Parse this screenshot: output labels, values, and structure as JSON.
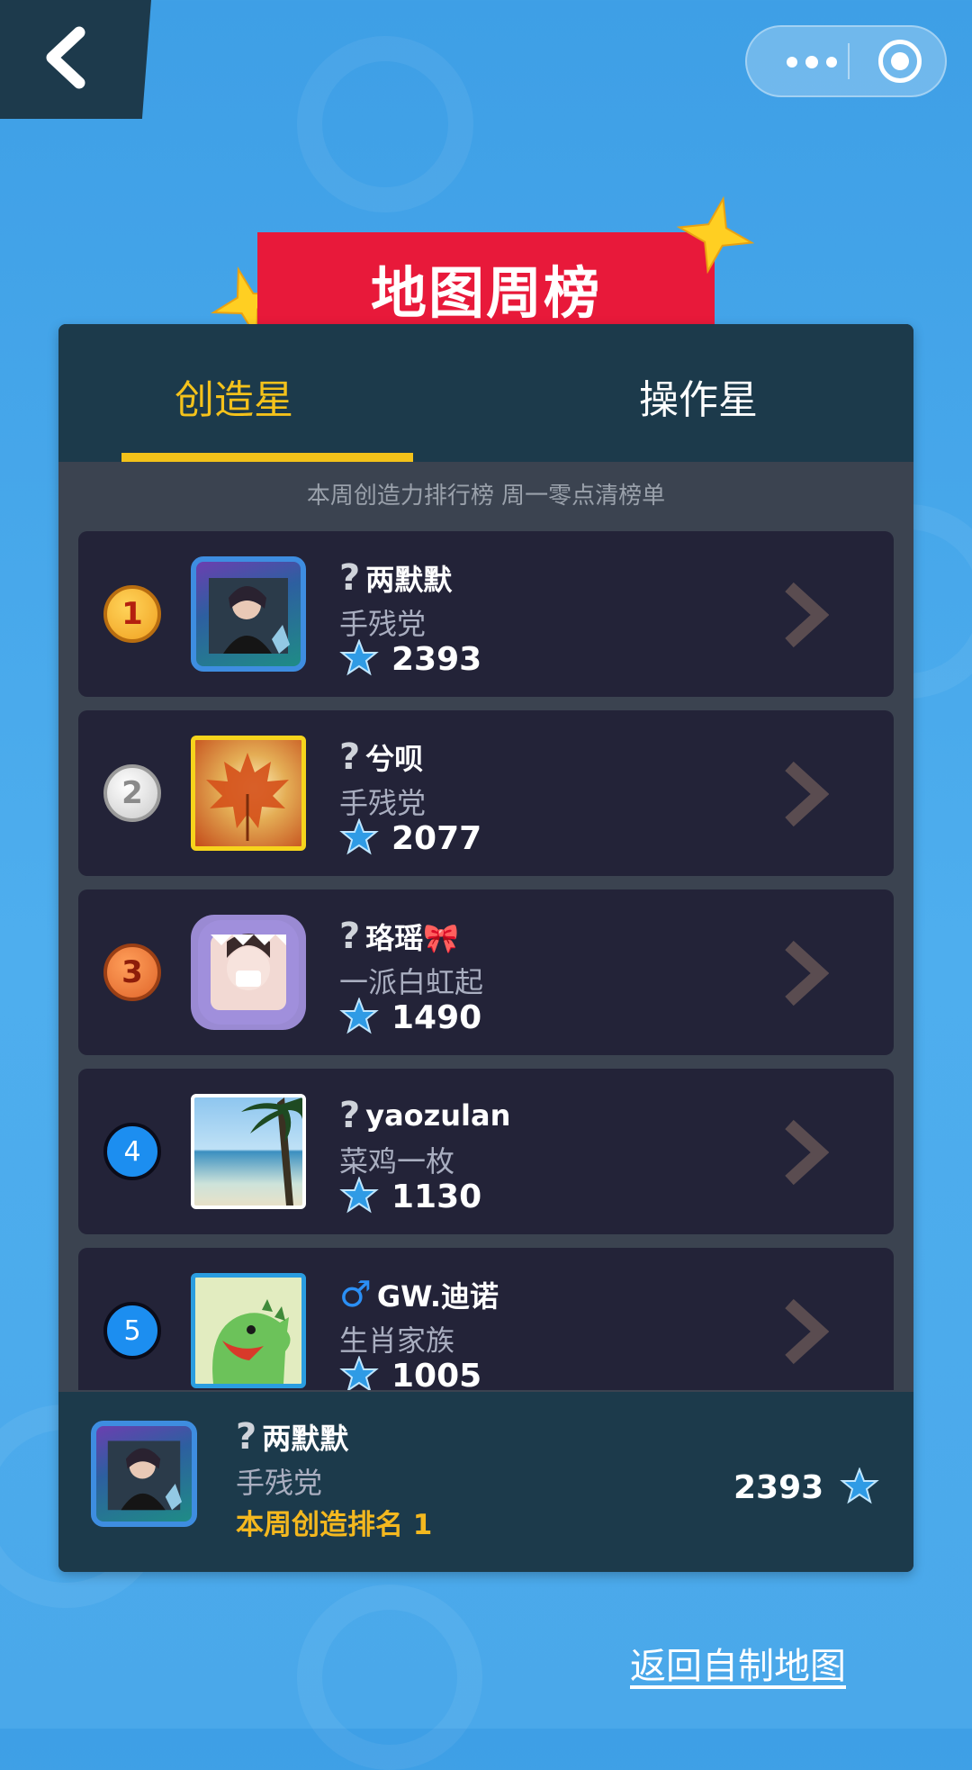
{
  "header": {
    "back_icon": "chevron-left-icon",
    "menu_icon": "more-dots-icon",
    "close_icon": "target-circle-icon"
  },
  "banner": {
    "title": "地图周榜"
  },
  "tabs": [
    {
      "label": "创造星",
      "active": true
    },
    {
      "label": "操作星",
      "active": false
    }
  ],
  "subtitle": "本周创造力排行榜 周一零点清榜单",
  "ranking": [
    {
      "rank": "1",
      "name": "两默默",
      "gender": "?",
      "title": "手残党",
      "score": "2393"
    },
    {
      "rank": "2",
      "name": "兮呗",
      "gender": "?",
      "title": "手残党",
      "score": "2077"
    },
    {
      "rank": "3",
      "name": "珞瑶🎀",
      "gender": "?",
      "title": "一派白虹起",
      "score": "1490"
    },
    {
      "rank": "4",
      "name": "yaozulan",
      "gender": "?",
      "title": "菜鸡一枚",
      "score": "1130"
    },
    {
      "rank": "5",
      "name": "GW.迪诺",
      "gender": "♂",
      "title": "生肖家族",
      "score": "1005"
    }
  ],
  "my_rank": {
    "name": "两默默",
    "gender": "?",
    "title": "手残党",
    "rank_text": "本周创造排名 1",
    "score": "2393"
  },
  "footer": {
    "return_label": "返回自制地图"
  },
  "colors": {
    "accent_yellow": "#f4c21b",
    "banner_red": "#e8193a",
    "panel_dark": "#1c3a4b",
    "row_bg": "#232338",
    "background_blue": "#4aa9ea"
  }
}
